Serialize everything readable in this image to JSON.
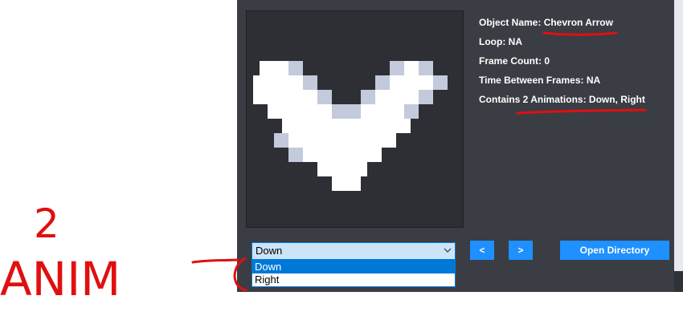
{
  "info": {
    "object_name": "Object Name: Chevron Arrow",
    "loop": "Loop: NA",
    "frame_count": "Frame Count: 0",
    "time_between": "Time Between Frames: NA",
    "animations": "Contains 2 Animations: Down, Right"
  },
  "animation_select": {
    "value": "Down",
    "options": [
      "Down",
      "Right"
    ]
  },
  "buttons": {
    "prev": "<",
    "next": ">",
    "open_directory": "Open Directory"
  },
  "annotation": {
    "number": "2",
    "text": "ANIM"
  },
  "colors": {
    "panel": "#3a3d44",
    "accent": "#1e90ff",
    "ink": "#e01010"
  },
  "icons": [
    "chevron-down-icon",
    "chevron-arrow-sprite"
  ]
}
